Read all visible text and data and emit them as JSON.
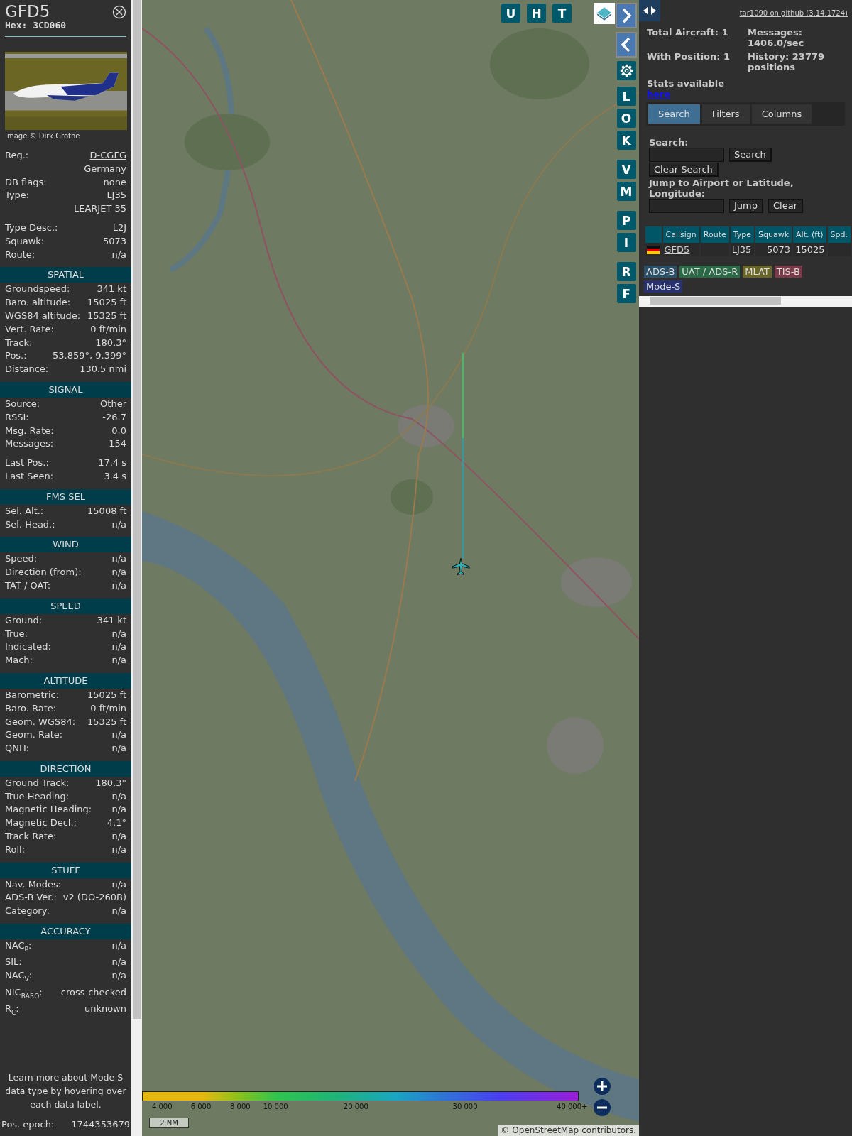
{
  "detail": {
    "callsign": "GFD5",
    "hex": "Hex: 3CD060",
    "photo_credit": "Image © Dirk Grothe",
    "sections": [
      {
        "groups": [
          [
            {
              "label": "Reg.:",
              "value": "D-CGFG",
              "kind": "link"
            },
            {
              "value": "Germany"
            },
            {
              "label": "DB flags:",
              "value": "none"
            },
            {
              "label": "Type:",
              "value": "LJ35"
            },
            {
              "value": "LEARJET 35"
            }
          ],
          [
            {
              "label": "Type Desc.:",
              "value": "L2J"
            },
            {
              "label": "Squawk:",
              "value": "5073"
            },
            {
              "label": "Route:",
              "value": "n/a"
            }
          ]
        ]
      },
      {
        "title": "SPATIAL",
        "groups": [
          [
            {
              "label": "Groundspeed:",
              "value": "341 kt"
            },
            {
              "label": "Baro. altitude:",
              "value": "15025 ft"
            },
            {
              "label": "WGS84 altitude:",
              "value": "15325 ft"
            },
            {
              "label": "Vert. Rate:",
              "value": "0 ft/min"
            },
            {
              "label": "Track:",
              "value": "180.3°"
            },
            {
              "label": "Pos.:",
              "value": "53.859°, 9.399°"
            },
            {
              "label": "Distance:",
              "value": "130.5 nmi"
            }
          ]
        ]
      },
      {
        "title": "SIGNAL",
        "groups": [
          [
            {
              "label": "Source:",
              "value": "Other"
            },
            {
              "label": "RSSI:",
              "value": "-26.7"
            },
            {
              "label": "Msg. Rate:",
              "value": "0.0"
            },
            {
              "label": "Messages:",
              "value": "154"
            }
          ],
          [
            {
              "label": "Last Pos.:",
              "value": "17.4 s"
            },
            {
              "label": "Last Seen:",
              "value": "3.4 s"
            }
          ]
        ]
      },
      {
        "title": "FMS SEL",
        "groups": [
          [
            {
              "label": "Sel. Alt.:",
              "value": "15008 ft"
            },
            {
              "label": "Sel. Head.:",
              "value": "n/a"
            }
          ]
        ]
      },
      {
        "title": "WIND",
        "groups": [
          [
            {
              "label": "Speed:",
              "value": "n/a"
            },
            {
              "label": "Direction (from):",
              "value": "n/a"
            },
            {
              "label": "TAT / OAT:",
              "value": "n/a"
            }
          ]
        ]
      },
      {
        "title": "SPEED",
        "groups": [
          [
            {
              "label": "Ground:",
              "value": "341 kt"
            },
            {
              "label": "True:",
              "value": "n/a"
            },
            {
              "label": "Indicated:",
              "value": "n/a"
            },
            {
              "label": "Mach:",
              "value": "n/a"
            }
          ]
        ]
      },
      {
        "title": "ALTITUDE",
        "groups": [
          [
            {
              "label": "Barometric:",
              "value": "15025 ft"
            },
            {
              "label": "Baro. Rate:",
              "value": "0 ft/min"
            },
            {
              "label": "Geom. WGS84:",
              "value": "15325 ft"
            },
            {
              "label": "Geom. Rate:",
              "value": "n/a"
            },
            {
              "label": "QNH:",
              "value": "n/a"
            }
          ]
        ]
      },
      {
        "title": "DIRECTION",
        "groups": [
          [
            {
              "label": "Ground Track:",
              "value": "180.3°"
            },
            {
              "label": "True Heading:",
              "value": "n/a"
            },
            {
              "label": "Magnetic Heading:",
              "value": "n/a"
            },
            {
              "label": "Magnetic Decl.:",
              "value": "4.1°"
            },
            {
              "label": "Track Rate:",
              "value": "n/a"
            },
            {
              "label": "Roll:",
              "value": "n/a"
            }
          ]
        ]
      },
      {
        "title": "STUFF",
        "groups": [
          [
            {
              "label": "Nav. Modes:",
              "value": "n/a"
            },
            {
              "label": "ADS-B Ver.:",
              "value": "v2 (DO-260B)"
            },
            {
              "label": "Category:",
              "value": "n/a"
            }
          ]
        ]
      },
      {
        "title": "ACCURACY",
        "groups": [
          [
            {
              "label": "NAC$_{P}$:",
              "value": "n/a"
            },
            {
              "label": "SIL:",
              "value": "n/a"
            },
            {
              "label": "NAC$_{V}$:",
              "value": "n/a"
            },
            {
              "label": "NIC$_{BARO}$:",
              "value": "cross-checked"
            },
            {
              "label": "R$_{C}$:",
              "value": "unknown"
            }
          ]
        ]
      }
    ],
    "note": "Learn more about Mode S data type by hovering over each data label.",
    "epoch": {
      "label": "Pos. epoch:",
      "value": "1744353679"
    }
  },
  "map": {
    "top_buttons": [
      "U",
      "H",
      "T"
    ],
    "side_buttons": [
      [
        "L",
        "O",
        "K"
      ],
      [
        "V",
        "M"
      ],
      [
        "P",
        "I"
      ],
      [
        "R",
        "F"
      ]
    ],
    "legend": [
      "4 000",
      "6 000",
      "8 000",
      "10 000",
      "20 000",
      "30 000",
      "40 000+"
    ],
    "scale": "2 NM",
    "attribution": {
      "prefix": "©",
      "link": "OpenStreetMap",
      "suffix": "contributors."
    }
  },
  "panel": {
    "github_link": "tar1090 on github (3.14.1724)",
    "stats": [
      {
        "label": "Total Aircraft:",
        "value": "1"
      },
      {
        "label": "Messages:",
        "value": "1406.0/sec"
      },
      {
        "label": "With Position:",
        "value": "1"
      },
      {
        "label": "History:",
        "value": "23779 positions"
      }
    ],
    "stats_text": "Stats available",
    "stats_link": "here",
    "tabs": [
      {
        "label": "Search",
        "selected": true
      },
      {
        "label": "Filters",
        "selected": false
      },
      {
        "label": "Columns",
        "selected": false
      }
    ],
    "search_label": "Search:",
    "search_button": "Search",
    "clear_search_button": "Clear Search",
    "jump_label": "Jump to Airport or Latitude, Longitude:",
    "jump_button": "Jump",
    "clear_button": "Clear",
    "table": {
      "columns": [
        "Callsign",
        "Route",
        "Type",
        "Squawk",
        "Alt. (ft)",
        "Spd."
      ],
      "rows": [
        {
          "callsign": "GFD5",
          "type": "LJ35",
          "squawk": "5073",
          "altitude": "15025"
        }
      ]
    },
    "sources": [
      {
        "label": "ADS-B",
        "color": "#2b4f66"
      },
      {
        "label": "UAT / ADS-R",
        "color": "#2b6a46"
      },
      {
        "label": "MLAT",
        "color": "#6a6529"
      },
      {
        "label": "TIS-B",
        "color": "#7a3c48"
      },
      {
        "label": "Mode-S",
        "color": "#27326e"
      }
    ]
  }
}
